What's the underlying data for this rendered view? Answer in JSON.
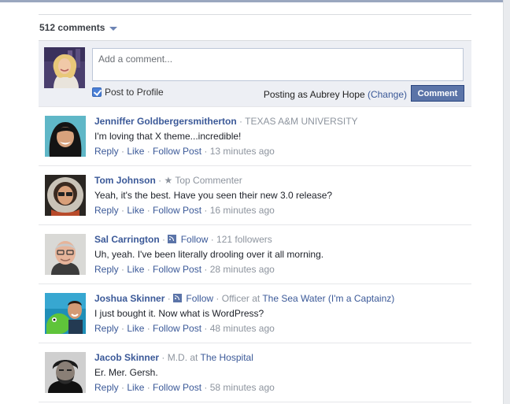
{
  "comments_header": {
    "count_label": "512 comments"
  },
  "composer": {
    "placeholder": "Add a comment...",
    "post_to_profile_label": "Post to Profile",
    "posting_as_label": "Posting as Aubrey Hope",
    "change_label": "(Change)",
    "comment_button_label": "Comment"
  },
  "comments": [
    {
      "author": "Jenniffer Goldbergersmitherton",
      "meta_prefix": " · ",
      "meta_text": "TEXAS A&M UNIVERSITY",
      "meta_link": "",
      "meta_suffix": "",
      "text": "I'm loving that X theme...incredible!",
      "reply": "Reply",
      "like": "Like",
      "follow_post": "Follow Post",
      "time": "13 minutes ago"
    },
    {
      "author": "Tom Johnson",
      "meta_prefix": " · ",
      "meta_text": "Top Commenter",
      "meta_link": "",
      "meta_suffix": "",
      "text": "Yeah, it's the best. Have you seen their new 3.0 release?",
      "reply": "Reply",
      "like": "Like",
      "follow_post": "Follow Post",
      "time": "16 minutes ago"
    },
    {
      "author": "Sal Carrington",
      "meta_prefix": " · ",
      "meta_link": "Follow",
      "meta_text": "",
      "meta_suffix": " · 121 followers",
      "text": "Uh, yeah. I've been literally drooling over it all morning.",
      "reply": "Reply",
      "like": "Like",
      "follow_post": "Follow Post",
      "time": "28 minutes ago"
    },
    {
      "author": "Joshua Skinner",
      "meta_prefix": " · ",
      "meta_link": "Follow",
      "meta_text": "",
      "meta_suffix": " · Officer at ",
      "meta_place": "The Sea Water (I'm a Captainz)",
      "text": "I just bought it. Now what is WordPress?",
      "reply": "Reply",
      "like": "Like",
      "follow_post": "Follow Post",
      "time": "48 minutes ago"
    },
    {
      "author": "Jacob Skinner",
      "meta_prefix": " · ",
      "meta_text": "M.D. at ",
      "meta_place": "The Hospital",
      "meta_link": "",
      "meta_suffix": "",
      "text": "Er. Mer. Gersh.",
      "reply": "Reply",
      "like": "Like",
      "follow_post": "Follow Post",
      "time": "58 minutes ago"
    }
  ],
  "colors": {
    "link": "#3b5998",
    "meta": "#8d949e",
    "button": "#5b74a8",
    "composer_bg": "#edeff4"
  }
}
